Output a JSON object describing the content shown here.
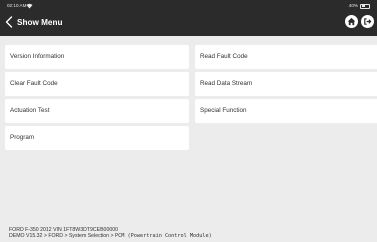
{
  "status_bar": {
    "time": "02:10 AM",
    "battery": "40%",
    "battery_level": 0.4,
    "wifi_icon": "wifi-icon",
    "battery_icon": "battery-icon"
  },
  "header": {
    "title": "Show Menu",
    "back_icon": "chevron-left-icon",
    "home_icon": "home-icon",
    "exit_icon": "exit-icon",
    "background": "#2b2b2b"
  },
  "menu": {
    "items": [
      {
        "label": "Version Information"
      },
      {
        "label": "Read Fault Code"
      },
      {
        "label": "Clear Fault Code"
      },
      {
        "label": "Read Data Stream"
      },
      {
        "label": "Actuation Test"
      },
      {
        "label": "Special Function"
      },
      {
        "label": "Program"
      }
    ]
  },
  "footer": {
    "vehicle_line": "FORD  F-350  2012  VIN  1FT8W3DT9CEB00000",
    "path_line": "DEMO V15.32 > FORD > System Selection > ",
    "module": "PCM (Powertrain Control Module)"
  }
}
